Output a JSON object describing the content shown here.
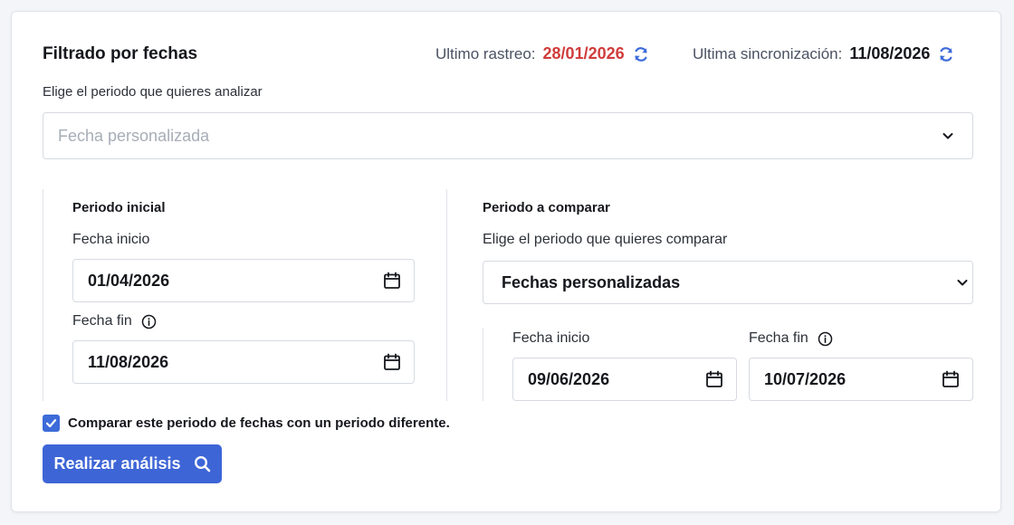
{
  "header": {
    "title": "Filtrado por fechas",
    "last_crawl_label": "Ultimo rastreo:",
    "last_crawl_value": "28/01/2026",
    "last_sync_label": "Ultima sincronización:",
    "last_sync_value": "11/08/2026"
  },
  "period_select": {
    "label": "Elige el periodo que quieres analizar",
    "placeholder": "Fecha personalizada"
  },
  "initial_period": {
    "title": "Periodo inicial",
    "start_label": "Fecha inicio",
    "start_value": "01/04/2026",
    "end_label": "Fecha fin",
    "end_value": "11/08/2026"
  },
  "compare_period": {
    "title": "Periodo a comparar",
    "select_label": "Elige el periodo que quieres comparar",
    "select_value": "Fechas personalizadas",
    "start_label": "Fecha inicio",
    "start_value": "09/06/2026",
    "end_label": "Fecha fin",
    "end_value": "10/07/2026"
  },
  "compare_checkbox": {
    "label": "Comparar este periodo de fechas con un periodo diferente.",
    "checked": true
  },
  "analyze_button": {
    "label": "Realizar análisis"
  },
  "icons": {
    "refresh": "refresh-icon",
    "chevron": "chevron-down-icon",
    "calendar": "calendar-icon",
    "info": "info-icon",
    "search": "search-icon",
    "check": "check-icon"
  },
  "colors": {
    "accent": "#3d65d6",
    "crawl_date": "#d03c3c",
    "refresh_icon": "#3d6bd9"
  }
}
